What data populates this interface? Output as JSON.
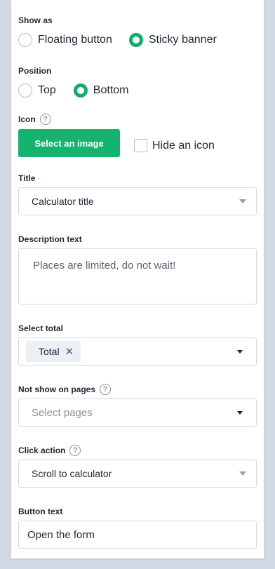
{
  "show_as": {
    "label": "Show as",
    "options": [
      {
        "label": "Floating button",
        "selected": false
      },
      {
        "label": "Sticky banner",
        "selected": true
      }
    ]
  },
  "position": {
    "label": "Position",
    "options": [
      {
        "label": "Top",
        "selected": false
      },
      {
        "label": "Bottom",
        "selected": true
      }
    ]
  },
  "icon": {
    "label": "Icon",
    "help": "?",
    "select_button": "Select an image",
    "hide_label": "Hide an icon",
    "hide_checked": false
  },
  "title": {
    "label": "Title",
    "value": "Calculator title"
  },
  "description": {
    "label": "Description text",
    "value": "Places are limited, do not wait!"
  },
  "select_total": {
    "label": "Select total",
    "tags": [
      "Total"
    ],
    "remove_symbol": "✕"
  },
  "not_show": {
    "label": "Not show on pages",
    "help": "?",
    "placeholder": "Select pages"
  },
  "click_action": {
    "label": "Click action",
    "help": "?",
    "value": "Scroll to calculator"
  },
  "button_text": {
    "label": "Button text",
    "value": "Open the form"
  },
  "colors": {
    "accent": "#16b36e",
    "background": "#d3d9e4",
    "border": "#d5d9df"
  }
}
